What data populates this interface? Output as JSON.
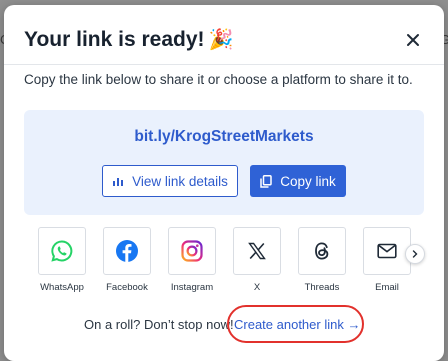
{
  "backdrop": {
    "left_fragment": "Cr",
    "right_fragment": "G"
  },
  "modal": {
    "title": "Your link is ready!",
    "title_emoji": "🎉",
    "subtitle": "Copy the link below to share it or choose a platform to share it to.",
    "short_link": "bit.ly/KrogStreetMarkets",
    "view_details_label": "View link details",
    "copy_label": "Copy link",
    "share_platforms": [
      {
        "label": "WhatsApp",
        "icon": "whatsapp-icon"
      },
      {
        "label": "Facebook",
        "icon": "facebook-icon"
      },
      {
        "label": "Instagram",
        "icon": "instagram-icon"
      },
      {
        "label": "X",
        "icon": "x-icon"
      },
      {
        "label": "Threads",
        "icon": "threads-icon"
      },
      {
        "label": "Email",
        "icon": "email-icon"
      }
    ],
    "footer_text": "On a roll? Don’t stop now!",
    "create_link_label": "Create another link",
    "create_link_arrow": "→"
  },
  "colors": {
    "accent": "#2e5bcc",
    "button_fill": "#2f62d6",
    "panel_bg": "#eaf1fd",
    "highlight": "#e2312c",
    "whatsapp": "#25d366",
    "facebook": "#1877f2"
  }
}
